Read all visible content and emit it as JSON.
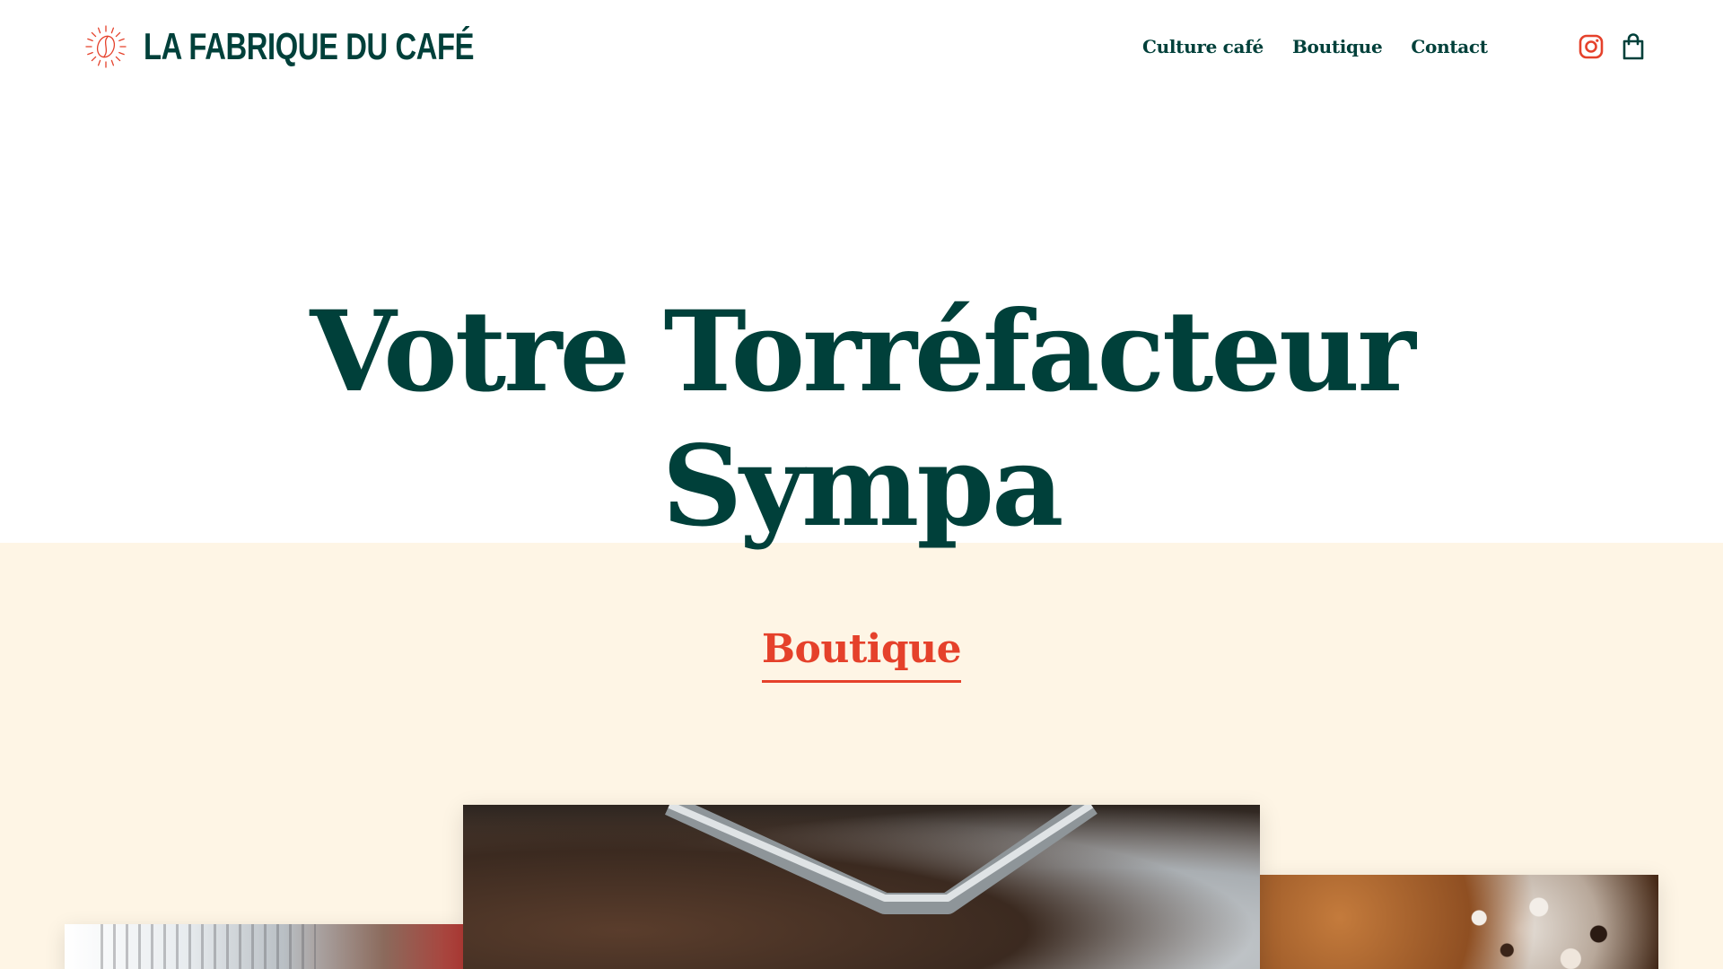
{
  "brand": {
    "name": "LA FABRIQUE DU CAFÉ",
    "logo_icon": "coffee-bean-sunburst-icon"
  },
  "nav": {
    "items": [
      {
        "label": "Culture café"
      },
      {
        "label": "Boutique"
      },
      {
        "label": "Contact"
      }
    ]
  },
  "header_icons": {
    "instagram": "instagram-icon",
    "cart": "shopping-bag-icon"
  },
  "hero": {
    "title_line1": "Votre Torréfacteur",
    "title_line2": "Sympa"
  },
  "section": {
    "heading": "Boutique"
  },
  "colors": {
    "primary_green": "#00403a",
    "accent_red": "#e5412b",
    "cream_background": "#fef5e5",
    "white": "#ffffff"
  }
}
